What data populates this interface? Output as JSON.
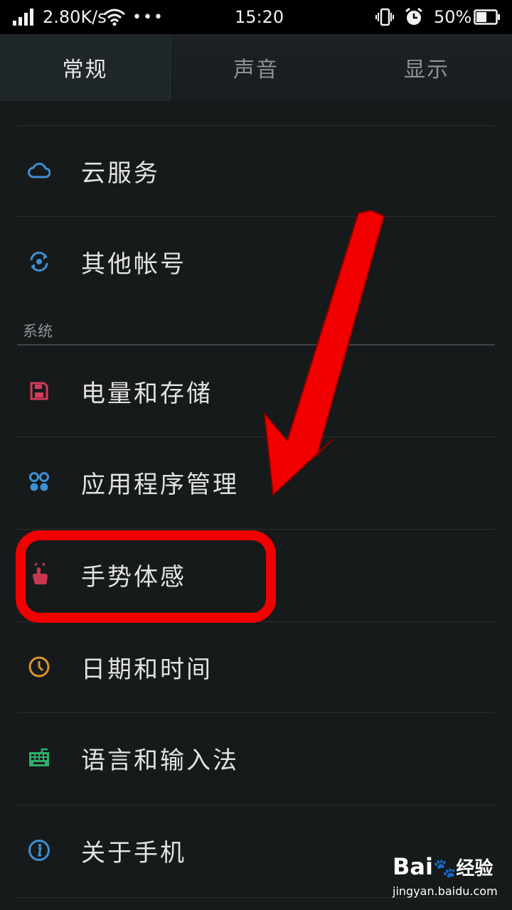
{
  "status_bar": {
    "net_speed": "2.80K/s",
    "dots": "•••",
    "time": "15:20",
    "battery": "50%"
  },
  "tabs": [
    {
      "label": "常规",
      "active": true
    },
    {
      "label": "声音",
      "active": false
    },
    {
      "label": "显示",
      "active": false
    }
  ],
  "settings": {
    "items_top": [
      {
        "label": "云服务",
        "icon": "cloud-icon",
        "color": "#3d8fd1"
      },
      {
        "label": "其他帐号",
        "icon": "account-sync-icon",
        "color": "#3d8fd1"
      }
    ],
    "section_system": "系统",
    "items_system": [
      {
        "label": "电量和存储",
        "icon": "storage-icon",
        "color": "#d33a5a"
      },
      {
        "label": "应用程序管理",
        "icon": "apps-icon",
        "color": "#3d8fd1"
      },
      {
        "label": "手势体感",
        "icon": "gesture-icon",
        "color": "#c8374f"
      },
      {
        "label": "日期和时间",
        "icon": "clock-icon",
        "color": "#d99530"
      },
      {
        "label": "语言和输入法",
        "icon": "keyboard-icon",
        "color": "#2fae6b"
      },
      {
        "label": "关于手机",
        "icon": "info-icon",
        "color": "#3d8fd1"
      }
    ]
  },
  "annotation_color": "#f20000",
  "watermark": {
    "brand": "Bai",
    "brand_cn": "经验",
    "url": "jingyan.baidu.com"
  }
}
